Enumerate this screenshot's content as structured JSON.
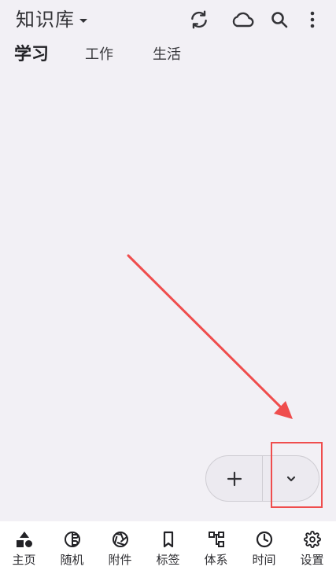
{
  "header": {
    "title": "知识库",
    "icons": [
      "sync-icon",
      "cloud-icon",
      "search-icon",
      "more-vert-icon"
    ]
  },
  "tabs": [
    {
      "label": "学习",
      "active": true
    },
    {
      "label": "工作",
      "active": false
    },
    {
      "label": "生活",
      "active": false
    }
  ],
  "fab": {
    "add_icon": "plus-icon",
    "expand_icon": "chevron-down-icon"
  },
  "annotation": {
    "color": "#ef4d4d"
  },
  "bottom_nav": {
    "items": [
      {
        "label": "主页",
        "icon": "shapes-icon"
      },
      {
        "label": "随机",
        "icon": "random-icon"
      },
      {
        "label": "附件",
        "icon": "aperture-icon"
      },
      {
        "label": "标签",
        "icon": "bookmark-icon"
      },
      {
        "label": "体系",
        "icon": "hierarchy-icon"
      },
      {
        "label": "时间",
        "icon": "clock-icon"
      },
      {
        "label": "设置",
        "icon": "gear-icon"
      }
    ]
  },
  "colors": {
    "background": "#f2f0f5",
    "nav_background": "#ffffff",
    "text": "#2a2a2e"
  }
}
